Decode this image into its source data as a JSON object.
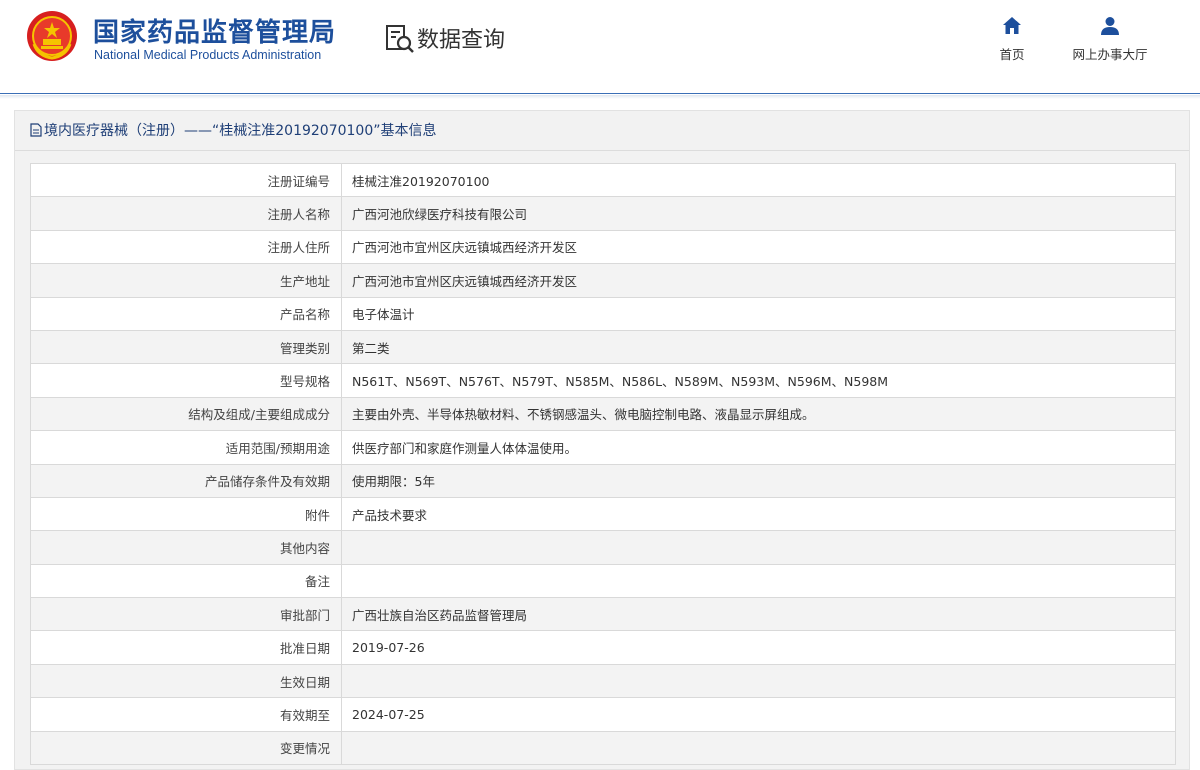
{
  "header": {
    "title_cn": "国家药品监督管理局",
    "title_en": "National Medical Products Administration",
    "query_title": "数据查询",
    "nav": {
      "home_label": "首页",
      "hall_label": "网上办事大厅"
    }
  },
  "colors": {
    "brand_blue": "#1d4f9c",
    "nav_icon": "#1d4f9c",
    "row_alt": "#f3f3f3",
    "border": "#d9d9d9"
  },
  "icons": {
    "logo": "national-emblem",
    "query": "search-document-icon",
    "home": "home-icon",
    "hall": "user-icon",
    "title": "document-icon"
  },
  "panel": {
    "title": "境内医疗器械（注册）——“桂械注准20192070100”基本信息"
  },
  "rows": [
    {
      "label": "注册证编号",
      "value": "桂械注准20192070100"
    },
    {
      "label": "注册人名称",
      "value": "广西河池欣绿医疗科技有限公司"
    },
    {
      "label": "注册人住所",
      "value": "广西河池市宜州区庆远镇城西经济开发区"
    },
    {
      "label": "生产地址",
      "value": "广西河池市宜州区庆远镇城西经济开发区"
    },
    {
      "label": "产品名称",
      "value": "电子体温计"
    },
    {
      "label": "管理类别",
      "value": "第二类"
    },
    {
      "label": "型号规格",
      "value": "N561T、N569T、N576T、N579T、N585M、N586L、N589M、N593M、N596M、N598M"
    },
    {
      "label": "结构及组成/主要组成成分",
      "value": "主要由外壳、半导体热敏材料、不锈钢感温头、微电脑控制电路、液晶显示屏组成。"
    },
    {
      "label": "适用范围/预期用途",
      "value": "供医疗部门和家庭作测量人体体温使用。"
    },
    {
      "label": "产品储存条件及有效期",
      "value": "使用期限：5年"
    },
    {
      "label": "附件",
      "value": "产品技术要求"
    },
    {
      "label": "其他内容",
      "value": ""
    },
    {
      "label": "备注",
      "value": ""
    },
    {
      "label": "审批部门",
      "value": "广西壮族自治区药品监督管理局"
    },
    {
      "label": "批准日期",
      "value": "2019-07-26"
    },
    {
      "label": "生效日期",
      "value": ""
    },
    {
      "label": "有效期至",
      "value": "2024-07-25"
    },
    {
      "label": "变更情况",
      "value": ""
    }
  ]
}
